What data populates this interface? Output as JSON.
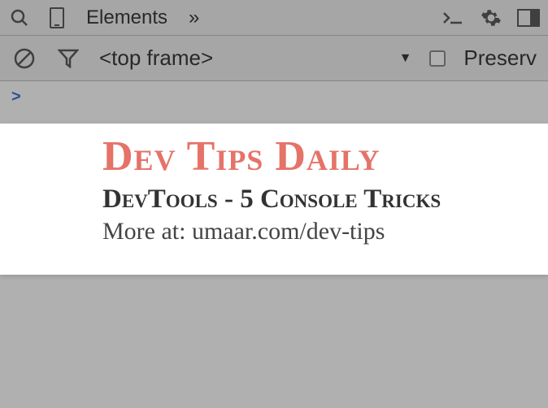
{
  "toolbar": {
    "tab_elements": "Elements",
    "overflow": "»"
  },
  "subtoolbar": {
    "frame": "<top frame>",
    "preserve": "Preserv"
  },
  "console": {
    "prompt": ">"
  },
  "overlay": {
    "title": "Dev Tips Daily",
    "subtitle": "DevTools - 5 Console Tricks",
    "more": "More at: umaar.com/dev-tips",
    "accent_color": "#e57368"
  }
}
